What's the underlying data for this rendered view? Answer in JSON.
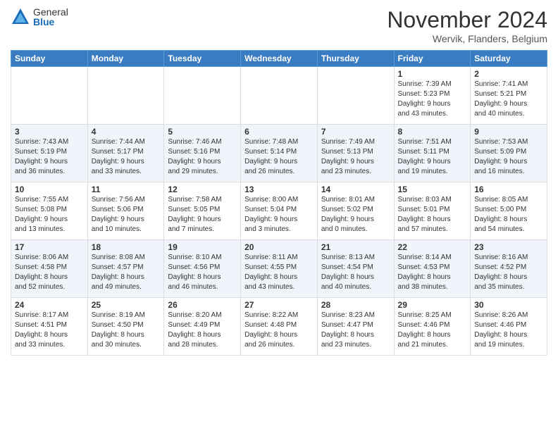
{
  "logo": {
    "general": "General",
    "blue": "Blue"
  },
  "title": "November 2024",
  "location": "Wervik, Flanders, Belgium",
  "headers": [
    "Sunday",
    "Monday",
    "Tuesday",
    "Wednesday",
    "Thursday",
    "Friday",
    "Saturday"
  ],
  "weeks": [
    [
      {
        "day": "",
        "info": ""
      },
      {
        "day": "",
        "info": ""
      },
      {
        "day": "",
        "info": ""
      },
      {
        "day": "",
        "info": ""
      },
      {
        "day": "",
        "info": ""
      },
      {
        "day": "1",
        "info": "Sunrise: 7:39 AM\nSunset: 5:23 PM\nDaylight: 9 hours\nand 43 minutes."
      },
      {
        "day": "2",
        "info": "Sunrise: 7:41 AM\nSunset: 5:21 PM\nDaylight: 9 hours\nand 40 minutes."
      }
    ],
    [
      {
        "day": "3",
        "info": "Sunrise: 7:43 AM\nSunset: 5:19 PM\nDaylight: 9 hours\nand 36 minutes."
      },
      {
        "day": "4",
        "info": "Sunrise: 7:44 AM\nSunset: 5:17 PM\nDaylight: 9 hours\nand 33 minutes."
      },
      {
        "day": "5",
        "info": "Sunrise: 7:46 AM\nSunset: 5:16 PM\nDaylight: 9 hours\nand 29 minutes."
      },
      {
        "day": "6",
        "info": "Sunrise: 7:48 AM\nSunset: 5:14 PM\nDaylight: 9 hours\nand 26 minutes."
      },
      {
        "day": "7",
        "info": "Sunrise: 7:49 AM\nSunset: 5:13 PM\nDaylight: 9 hours\nand 23 minutes."
      },
      {
        "day": "8",
        "info": "Sunrise: 7:51 AM\nSunset: 5:11 PM\nDaylight: 9 hours\nand 19 minutes."
      },
      {
        "day": "9",
        "info": "Sunrise: 7:53 AM\nSunset: 5:09 PM\nDaylight: 9 hours\nand 16 minutes."
      }
    ],
    [
      {
        "day": "10",
        "info": "Sunrise: 7:55 AM\nSunset: 5:08 PM\nDaylight: 9 hours\nand 13 minutes."
      },
      {
        "day": "11",
        "info": "Sunrise: 7:56 AM\nSunset: 5:06 PM\nDaylight: 9 hours\nand 10 minutes."
      },
      {
        "day": "12",
        "info": "Sunrise: 7:58 AM\nSunset: 5:05 PM\nDaylight: 9 hours\nand 7 minutes."
      },
      {
        "day": "13",
        "info": "Sunrise: 8:00 AM\nSunset: 5:04 PM\nDaylight: 9 hours\nand 3 minutes."
      },
      {
        "day": "14",
        "info": "Sunrise: 8:01 AM\nSunset: 5:02 PM\nDaylight: 9 hours\nand 0 minutes."
      },
      {
        "day": "15",
        "info": "Sunrise: 8:03 AM\nSunset: 5:01 PM\nDaylight: 8 hours\nand 57 minutes."
      },
      {
        "day": "16",
        "info": "Sunrise: 8:05 AM\nSunset: 5:00 PM\nDaylight: 8 hours\nand 54 minutes."
      }
    ],
    [
      {
        "day": "17",
        "info": "Sunrise: 8:06 AM\nSunset: 4:58 PM\nDaylight: 8 hours\nand 52 minutes."
      },
      {
        "day": "18",
        "info": "Sunrise: 8:08 AM\nSunset: 4:57 PM\nDaylight: 8 hours\nand 49 minutes."
      },
      {
        "day": "19",
        "info": "Sunrise: 8:10 AM\nSunset: 4:56 PM\nDaylight: 8 hours\nand 46 minutes."
      },
      {
        "day": "20",
        "info": "Sunrise: 8:11 AM\nSunset: 4:55 PM\nDaylight: 8 hours\nand 43 minutes."
      },
      {
        "day": "21",
        "info": "Sunrise: 8:13 AM\nSunset: 4:54 PM\nDaylight: 8 hours\nand 40 minutes."
      },
      {
        "day": "22",
        "info": "Sunrise: 8:14 AM\nSunset: 4:53 PM\nDaylight: 8 hours\nand 38 minutes."
      },
      {
        "day": "23",
        "info": "Sunrise: 8:16 AM\nSunset: 4:52 PM\nDaylight: 8 hours\nand 35 minutes."
      }
    ],
    [
      {
        "day": "24",
        "info": "Sunrise: 8:17 AM\nSunset: 4:51 PM\nDaylight: 8 hours\nand 33 minutes."
      },
      {
        "day": "25",
        "info": "Sunrise: 8:19 AM\nSunset: 4:50 PM\nDaylight: 8 hours\nand 30 minutes."
      },
      {
        "day": "26",
        "info": "Sunrise: 8:20 AM\nSunset: 4:49 PM\nDaylight: 8 hours\nand 28 minutes."
      },
      {
        "day": "27",
        "info": "Sunrise: 8:22 AM\nSunset: 4:48 PM\nDaylight: 8 hours\nand 26 minutes."
      },
      {
        "day": "28",
        "info": "Sunrise: 8:23 AM\nSunset: 4:47 PM\nDaylight: 8 hours\nand 23 minutes."
      },
      {
        "day": "29",
        "info": "Sunrise: 8:25 AM\nSunset: 4:46 PM\nDaylight: 8 hours\nand 21 minutes."
      },
      {
        "day": "30",
        "info": "Sunrise: 8:26 AM\nSunset: 4:46 PM\nDaylight: 8 hours\nand 19 minutes."
      }
    ]
  ]
}
